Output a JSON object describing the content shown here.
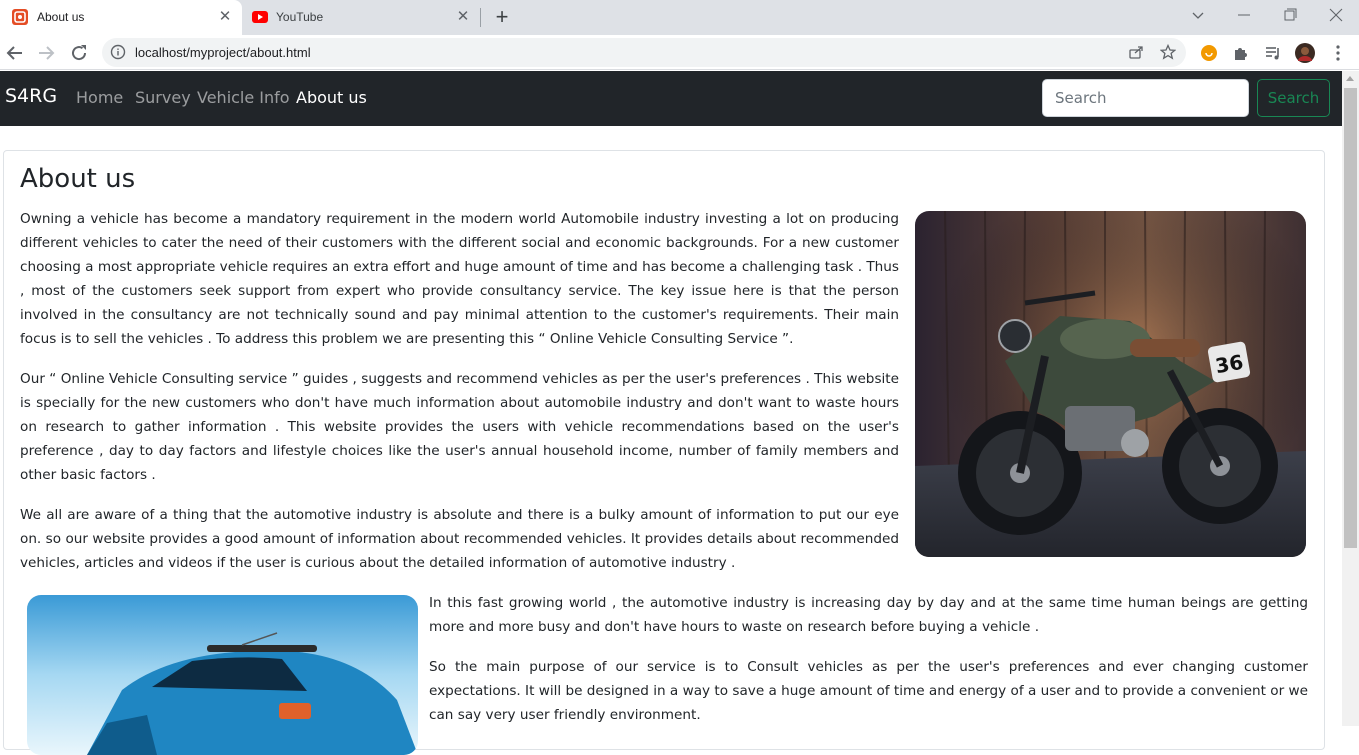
{
  "browser": {
    "tabs": [
      {
        "title": "About us",
        "favicon": "html5-icon",
        "active": true
      },
      {
        "title": "YouTube",
        "favicon": "youtube-icon",
        "active": false
      }
    ],
    "url": "localhost/myproject/about.html"
  },
  "navbar": {
    "brand": "S4RG",
    "links": [
      {
        "label": "Home",
        "active": false
      },
      {
        "label": "Survey",
        "active": false
      },
      {
        "label": "Vehicle Info",
        "active": false
      },
      {
        "label": "About us",
        "active": true
      }
    ],
    "search_placeholder": "Search",
    "search_button": "Search"
  },
  "colors": {
    "navbar_bg": "#212529",
    "search_button": "#198754"
  },
  "content": {
    "heading": "About us",
    "paragraphs": [
      "Owning a vehicle has become a mandatory requirement in the modern world Automobile industry investing a lot on producing different vehicles to cater the need of their customers with the different social and economic backgrounds. For a new customer choosing a most appropriate vehicle requires an extra effort and huge amount of time and has become a challenging task . Thus , most of the customers seek support from expert who provide consultancy service. The key issue here is that the person involved in the consultancy are not technically sound and pay minimal attention to the customer's requirements. Their main focus is to sell the vehicles . To address this problem we are presenting this “ Online Vehicle Consulting Service ”.",
      "Our “ Online Vehicle Consulting service ” guides , suggests and recommend vehicles as per the user's preferences . This website is specially for the new customers who don't have much information about automobile industry and don't want to waste hours on research to gather information . This website provides the users with vehicle recommendations based on the user's preference , day to day factors and lifestyle choices like the user's annual household income, number of family members and other basic factors .",
      "We all are aware of a thing that the automotive industry is absolute and there is a bulky amount of information to put our eye on. so our website provides a good amount of information about recommended vehicles. It provides details about recommended vehicles, articles and videos if the user is curious about the detailed information of automotive industry .",
      "In this fast growing world , the automotive industry is increasing day by day and at the same time human beings are getting more and more busy and don't have hours to waste on research before buying a vehicle .",
      "So the main purpose of our service is to Consult vehicles as per the user's preferences and ever changing customer expectations. It will be designed in a way to save a huge amount of time and energy of a user and to provide a convenient or we can say very user friendly environment."
    ],
    "motorcycle_number": "36"
  }
}
